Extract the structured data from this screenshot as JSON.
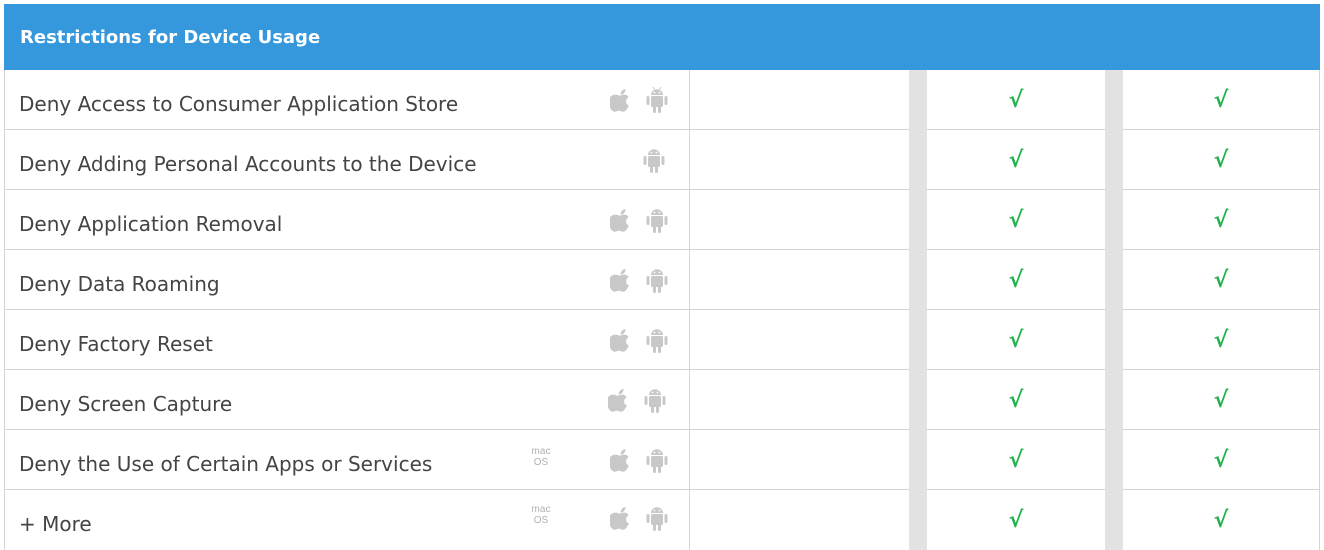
{
  "header": {
    "title": "Restrictions for Device Usage"
  },
  "colors": {
    "header_bg": "#3598dc",
    "check": "#22b14c",
    "icon": "#c8c8c8",
    "gap": "#e2e2e2"
  },
  "check_mark": "√",
  "macos_badge": {
    "line1": "mac",
    "line2": "OS"
  },
  "rows": [
    {
      "label": "Deny Access to Consumer Application Store",
      "icons": [
        "apple-icon",
        "android-icon"
      ],
      "check1": "√",
      "check2": "√"
    },
    {
      "label": "Deny Adding Personal Accounts to the Device",
      "icons": [
        "android-icon"
      ],
      "check1": "√",
      "check2": "√"
    },
    {
      "label": "Deny Application Removal",
      "icons": [
        "apple-icon",
        "android-icon"
      ],
      "check1": "√",
      "check2": "√"
    },
    {
      "label": "Deny Data Roaming",
      "icons": [
        "apple-icon",
        "android-icon"
      ],
      "check1": "√",
      "check2": "√"
    },
    {
      "label": "Deny Factory Reset",
      "icons": [
        "apple-icon",
        "android-icon"
      ],
      "check1": "√",
      "check2": "√"
    },
    {
      "label": "Deny Screen Capture",
      "icons": [
        "apple-icon",
        "android-icon"
      ],
      "check1": "√",
      "check2": "√"
    },
    {
      "label": "Deny the Use of Certain Apps or Services",
      "icons": [
        "macos-icon",
        "apple-icon",
        "android-icon"
      ],
      "check1": "√",
      "check2": "√"
    },
    {
      "label": "+ More",
      "icons": [
        "macos-icon",
        "apple-icon",
        "android-icon"
      ],
      "check1": "√",
      "check2": "√"
    }
  ]
}
